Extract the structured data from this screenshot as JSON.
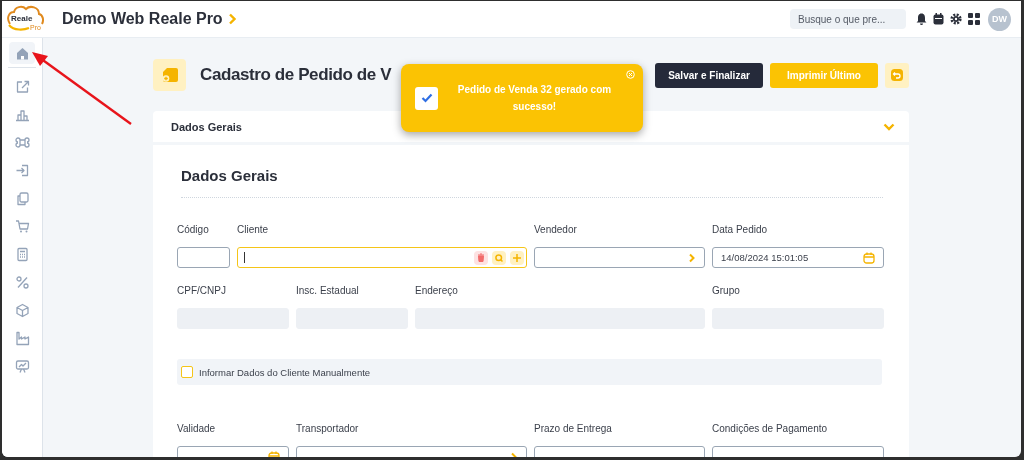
{
  "topbar": {
    "logo_word": "Reale",
    "logo_sub": "Pro",
    "title": "Demo Web Reale Pro",
    "search": {
      "placeholder": "Busque o que pre..."
    },
    "avatar": "DW"
  },
  "sidebar": {
    "items": [
      {
        "selected": true
      },
      {
        "selected": false
      },
      {
        "selected": false
      },
      {
        "selected": false
      },
      {
        "selected": false
      },
      {
        "selected": false
      },
      {
        "selected": false
      },
      {
        "selected": false
      },
      {
        "selected": false
      },
      {
        "selected": false
      },
      {
        "selected": false
      },
      {
        "selected": false
      }
    ]
  },
  "page": {
    "title": "Cadastro de Pedido de V",
    "buttons": [
      {
        "label": "Salvar e Finalizar",
        "kind": "dark"
      },
      {
        "label": "Imprimir Último",
        "kind": "primary"
      }
    ]
  },
  "toast": {
    "message": "Pedido de Venda 32 gerado com sucesso!",
    "checked": true
  },
  "section": {
    "header": "Dados Gerais",
    "expanded": true,
    "heading": "Dados Gerais",
    "rows": [
      {
        "kind": "fields",
        "fields": [
          {
            "label": "Código",
            "kind": "text"
          },
          {
            "label": "Cliente",
            "kind": "lookup",
            "focused": true
          },
          {
            "label": "Vendedor",
            "kind": "select"
          },
          {
            "label": "Data Pedido",
            "kind": "date",
            "value": "14/08/2024 15:01:05"
          }
        ]
      },
      {
        "kind": "fields",
        "fields": [
          {
            "label": "CPF/CNPJ",
            "kind": "readonly"
          },
          {
            "label": "Insc. Estadual",
            "kind": "readonly"
          },
          {
            "label": "Endereço",
            "kind": "readonly"
          },
          {
            "label": "Grupo",
            "kind": "readonly"
          }
        ]
      },
      {
        "kind": "checkbox",
        "label": "Informar Dados do Cliente Manualmente",
        "checked": false
      },
      {
        "kind": "fields",
        "fields": [
          {
            "label": "Validade",
            "kind": "date"
          },
          {
            "label": "Transportador",
            "kind": "select"
          },
          {
            "label": "Prazo de Entrega",
            "kind": "text"
          },
          {
            "label": "Condições de Pagamento",
            "kind": "text"
          }
        ]
      }
    ]
  }
}
